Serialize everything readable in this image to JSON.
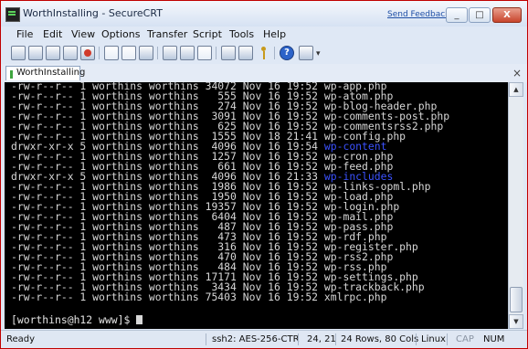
{
  "window": {
    "title": "WorthInstalling - SecureCRT",
    "feedback_link": "Send Feedback",
    "min_glyph": "_",
    "max_glyph": "□",
    "close_glyph": "X"
  },
  "menu": [
    "File",
    "Edit",
    "View",
    "Options",
    "Transfer",
    "Script",
    "Tools",
    "Help"
  ],
  "toolbar_icons": [
    "connect-icon",
    "quick-connect-icon",
    "connect-in-tab-icon",
    "reconnect-icon",
    "disconnect-icon",
    "copy-icon",
    "paste-icon",
    "find-icon",
    "print-icon",
    "print-setup-icon",
    "session-options-icon",
    "global-options-icon",
    "keymap-icon",
    "help-icon",
    "sftp-icon",
    "overflow-icon"
  ],
  "tab": {
    "label": "WorthInstalling",
    "close_glyph": "×"
  },
  "terminal": {
    "lines": [
      {
        "text": "-rw-r--r-- 1 worthins worthins 34072 Nov 16 19:52 ",
        "name": "wp-app.php",
        "dir": false
      },
      {
        "text": "-rw-r--r-- 1 worthins worthins   555 Nov 16 19:52 ",
        "name": "wp-atom.php",
        "dir": false
      },
      {
        "text": "-rw-r--r-- 1 worthins worthins   274 Nov 16 19:52 ",
        "name": "wp-blog-header.php",
        "dir": false
      },
      {
        "text": "-rw-r--r-- 1 worthins worthins  3091 Nov 16 19:52 ",
        "name": "wp-comments-post.php",
        "dir": false
      },
      {
        "text": "-rw-r--r-- 1 worthins worthins   625 Nov 16 19:52 ",
        "name": "wp-commentsrss2.php",
        "dir": false
      },
      {
        "text": "-rw-r--r-- 1 worthins worthins  1555 Nov 18 21:41 ",
        "name": "wp-config.php",
        "dir": false
      },
      {
        "text": "drwxr-xr-x 5 worthins worthins  4096 Nov 16 19:54 ",
        "name": "wp-content",
        "dir": true
      },
      {
        "text": "-rw-r--r-- 1 worthins worthins  1257 Nov 16 19:52 ",
        "name": "wp-cron.php",
        "dir": false
      },
      {
        "text": "-rw-r--r-- 1 worthins worthins   661 Nov 16 19:52 ",
        "name": "wp-feed.php",
        "dir": false
      },
      {
        "text": "drwxr-xr-x 5 worthins worthins  4096 Nov 16 21:33 ",
        "name": "wp-includes",
        "dir": true
      },
      {
        "text": "-rw-r--r-- 1 worthins worthins  1986 Nov 16 19:52 ",
        "name": "wp-links-opml.php",
        "dir": false
      },
      {
        "text": "-rw-r--r-- 1 worthins worthins  1950 Nov 16 19:52 ",
        "name": "wp-load.php",
        "dir": false
      },
      {
        "text": "-rw-r--r-- 1 worthins worthins 19357 Nov 16 19:52 ",
        "name": "wp-login.php",
        "dir": false
      },
      {
        "text": "-rw-r--r-- 1 worthins worthins  6404 Nov 16 19:52 ",
        "name": "wp-mail.php",
        "dir": false
      },
      {
        "text": "-rw-r--r-- 1 worthins worthins   487 Nov 16 19:52 ",
        "name": "wp-pass.php",
        "dir": false
      },
      {
        "text": "-rw-r--r-- 1 worthins worthins   473 Nov 16 19:52 ",
        "name": "wp-rdf.php",
        "dir": false
      },
      {
        "text": "-rw-r--r-- 1 worthins worthins   316 Nov 16 19:52 ",
        "name": "wp-register.php",
        "dir": false
      },
      {
        "text": "-rw-r--r-- 1 worthins worthins   470 Nov 16 19:52 ",
        "name": "wp-rss2.php",
        "dir": false
      },
      {
        "text": "-rw-r--r-- 1 worthins worthins   484 Nov 16 19:52 ",
        "name": "wp-rss.php",
        "dir": false
      },
      {
        "text": "-rw-r--r-- 1 worthins worthins 17171 Nov 16 19:52 ",
        "name": "wp-settings.php",
        "dir": false
      },
      {
        "text": "-rw-r--r-- 1 worthins worthins  3434 Nov 16 19:52 ",
        "name": "wp-trackback.php",
        "dir": false
      },
      {
        "text": "-rw-r--r-- 1 worthins worthins 75403 Nov 16 19:52 ",
        "name": "xmlrpc.php",
        "dir": false
      }
    ],
    "prompt": "[worthins@h12 www]$ "
  },
  "status": {
    "ready": "Ready",
    "cipher": "ssh2: AES-256-CTR",
    "position": "24, 21",
    "size": "24 Rows, 80 Cols",
    "terminal_type": "Linux",
    "cap": "CAP",
    "num": "NUM"
  },
  "colors": {
    "directory": "#3b52ff",
    "text": "#d7d7d7",
    "background": "#000000"
  }
}
